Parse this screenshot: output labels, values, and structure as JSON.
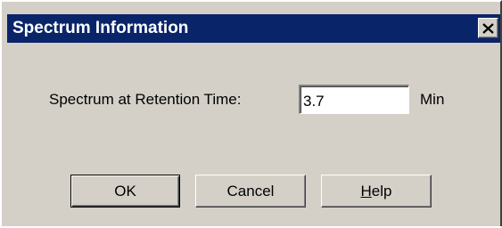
{
  "window": {
    "title": "Spectrum Information",
    "close_icon": "close-icon",
    "colors": {
      "titlebar": "#0a246a",
      "face": "#d4d0c8"
    }
  },
  "form": {
    "label": "Spectrum at Retention Time:",
    "value": "3.7",
    "unit": "Min"
  },
  "buttons": {
    "ok_label": "OK",
    "cancel_label": "Cancel",
    "help_mnemonic": "H",
    "help_rest": "elp"
  }
}
